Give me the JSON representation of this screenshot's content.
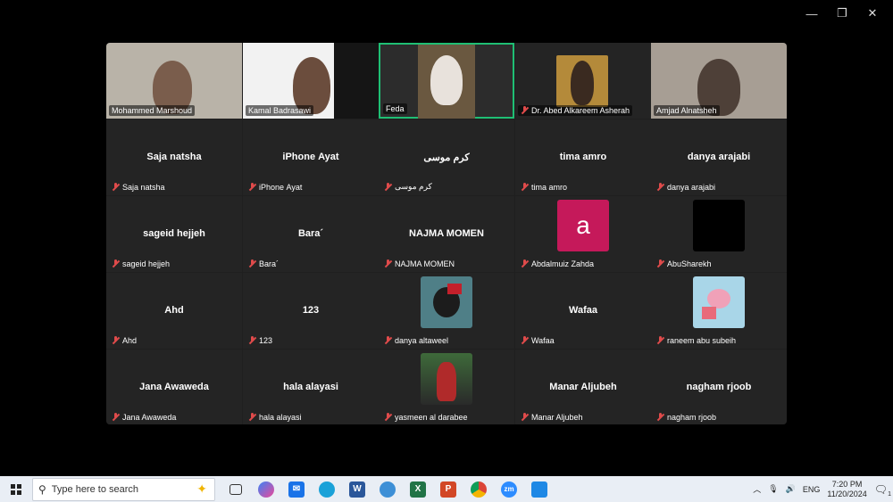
{
  "window_controls": {
    "minimize": "—",
    "restore": "❐",
    "close": "✕"
  },
  "video_tiles": [
    {
      "name": "Mohammed Marshoud",
      "muted": false
    },
    {
      "name": "Kamal Badrasawi",
      "muted": false
    },
    {
      "name": "Feda",
      "muted": false,
      "active": true
    },
    {
      "name": "Dr. Abed Alkareem Asherah",
      "muted": true
    },
    {
      "name": "Amjad Alnatsheh",
      "muted": false
    }
  ],
  "participants": [
    {
      "display": "Saja natsha",
      "label": "Saja natsha"
    },
    {
      "display": "iPhone \u0001Ayat\u0001",
      "label": "iPhone \u0001Ayat\u0001"
    },
    {
      "display": "كرم موسى",
      "label": "كرم موسى"
    },
    {
      "display": "tima amro",
      "label": "tima amro"
    },
    {
      "display": "danya arajabi",
      "label": "danya arajabi"
    },
    {
      "display": "sageid hejjeh",
      "label": "sageid hejjeh"
    },
    {
      "display": "Bara´",
      "label": "Bara´"
    },
    {
      "display": "NAJMA MOMEN",
      "label": "NAJMA MOMEN"
    },
    {
      "display": "",
      "label": "Abdalmuiz Zahda",
      "avatar": "a"
    },
    {
      "display": "",
      "label": "AbuSharekh",
      "avatar": "black"
    },
    {
      "display": "Ahd",
      "label": "Ahd"
    },
    {
      "display": "123",
      "label": "123"
    },
    {
      "display": "",
      "label": "danya altaweel",
      "avatar": "flag"
    },
    {
      "display": "Wafaa",
      "label": "Wafaa"
    },
    {
      "display": "",
      "label": "raneem abu subeih",
      "avatar": "pink"
    },
    {
      "display": "Jana Awaweda",
      "label": "Jana Awaweda"
    },
    {
      "display": "hala alayasi",
      "label": "hala alayasi"
    },
    {
      "display": "",
      "label": "yasmeen al darabee",
      "avatar": "photo"
    },
    {
      "display": "Manar Aljubeh",
      "label": "Manar Aljubeh"
    },
    {
      "display": "nagham rjoob",
      "label": "nagham rjoob"
    }
  ],
  "avatar_letter": "a",
  "taskbar": {
    "search_placeholder": "Type here to search",
    "apps": [
      "task-view",
      "copilot",
      "mail",
      "edge",
      "word",
      "photos",
      "excel",
      "powerpoint",
      "chrome",
      "zoom",
      "photos-app"
    ],
    "lang": "ENG",
    "time": "7:20 PM",
    "date": "11/20/2024",
    "notification_count": "1"
  },
  "colors": {
    "active_border": "#1fbf74",
    "muted_icon": "#e04b4b",
    "avatar_a": "#c5195a"
  }
}
